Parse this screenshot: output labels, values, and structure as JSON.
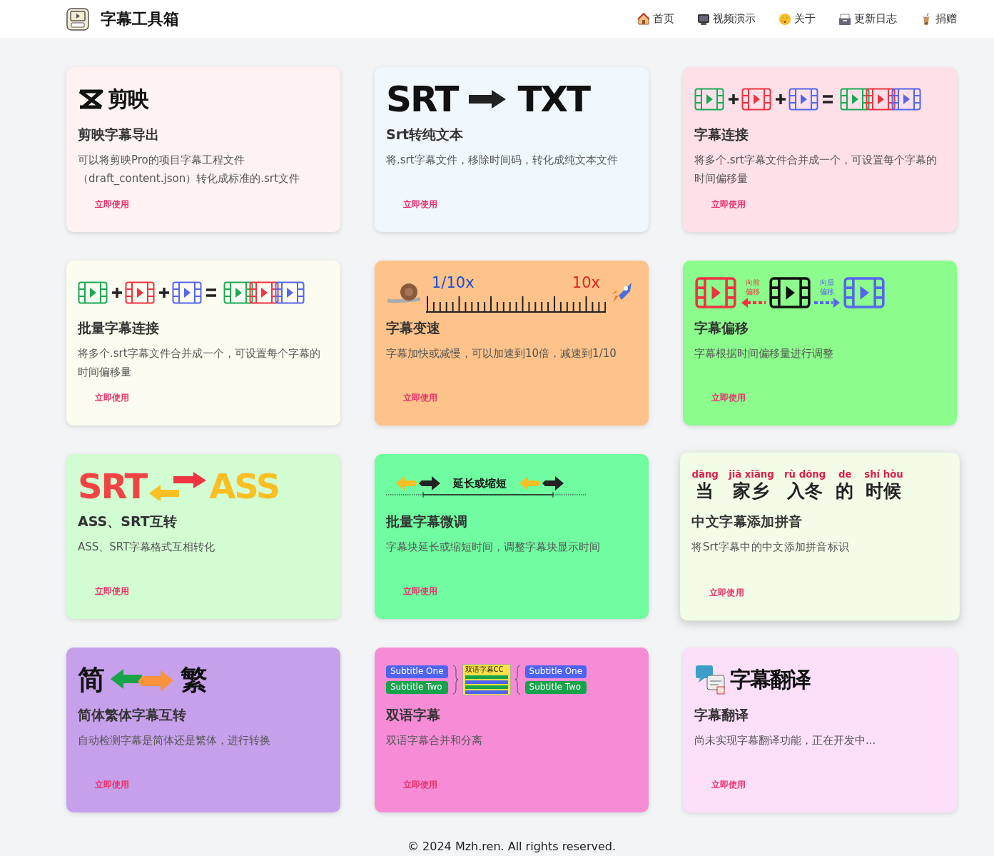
{
  "navbar": {
    "brand": "字幕工具箱",
    "links": [
      {
        "label": "首页"
      },
      {
        "label": "视频演示"
      },
      {
        "label": "关于"
      },
      {
        "label": "更新日志"
      },
      {
        "label": "捐赠"
      }
    ]
  },
  "cards": [
    {
      "color": "#fef2f2",
      "raised": false,
      "banner": {
        "kind": "jianying",
        "texts": [
          "剪映"
        ]
      },
      "title": "剪映字幕导出",
      "description": "可以将剪映Pro的项目字幕工程文件（draft_content.json）转化成标准的.srt文件",
      "action": "立即使用"
    },
    {
      "color": "#f0f7fd",
      "raised": false,
      "banner": {
        "kind": "srt_txt",
        "texts": [
          "SRT",
          "TXT"
        ]
      },
      "title": "Srt转纯文本",
      "description": "将.srt字幕文件，移除时间码，转化成纯文本文件",
      "action": "立即使用"
    },
    {
      "color": "#fde0e8",
      "raised": false,
      "banner": {
        "kind": "merge"
      },
      "title": "字幕连接",
      "description": "将多个.srt字幕文件合并成一个，可设置每个字幕的时间偏移量",
      "action": "立即使用"
    },
    {
      "color": "#fcfcf0",
      "raised": false,
      "banner": {
        "kind": "merge"
      },
      "title": "批量字幕连接",
      "description": "将多个.srt字幕文件合并成一个，可设置每个字幕的时间偏移量",
      "action": "立即使用"
    },
    {
      "color": "#fec38a",
      "raised": false,
      "banner": {
        "kind": "speed",
        "texts": [
          "1/10x",
          "10x"
        ]
      },
      "title": "字幕变速",
      "description": "字幕加快或减慢，可以加速到10倍，减速到1/10",
      "action": "立即使用"
    },
    {
      "color": "#8cfc8c",
      "raised": false,
      "banner": {
        "kind": "offset",
        "texts": [
          "向前偏移",
          "向后偏移"
        ]
      },
      "title": "字幕偏移",
      "description": "字幕根据时间偏移量进行调整",
      "action": "立即使用"
    },
    {
      "color": "#d2fcd2",
      "raised": false,
      "banner": {
        "kind": "srt_ass",
        "texts": [
          "SRT",
          "ASS"
        ]
      },
      "title": "ASS、SRT互转",
      "description": "ASS、SRT字幕格式互相转化",
      "action": "立即使用"
    },
    {
      "color": "#70fca0",
      "raised": false,
      "banner": {
        "kind": "fine_tune",
        "texts": [
          "延长或缩短"
        ]
      },
      "title": "批量字幕微调",
      "description": "字幕块延长或缩短时间，调整字幕块显示时间",
      "action": "立即使用"
    },
    {
      "color": "#f2fce6",
      "raised": true,
      "banner": {
        "kind": "pinyin",
        "pairs": [
          {
            "pinyin": "dāng",
            "hanzi": "当"
          },
          {
            "pinyin": "jiā xiāng",
            "hanzi": "家乡"
          },
          {
            "pinyin": "rù dōng",
            "hanzi": "入冬"
          },
          {
            "pinyin": "de",
            "hanzi": "的"
          },
          {
            "pinyin": "shí hòu",
            "hanzi": "时候"
          }
        ]
      },
      "title": "中文字幕添加拼音",
      "description": "将Srt字幕中的中文添加拼音标识",
      "action": "立即使用"
    },
    {
      "color": "#c6a0ea",
      "raised": false,
      "banner": {
        "kind": "simp_trad",
        "texts": [
          "简",
          "繁"
        ]
      },
      "title": "简体繁体字幕互转",
      "description": "自动检测字幕是简体还是繁体，进行转换",
      "action": "立即使用"
    },
    {
      "color": "#f68cd6",
      "raised": false,
      "banner": {
        "kind": "bilingual",
        "texts": [
          "Subtitle One",
          "Subtitle Two",
          "双语字幕CC",
          "Subtitle One",
          "Subtitle Two"
        ]
      },
      "title": "双语字幕",
      "description": "双语字幕合并和分离",
      "action": "立即使用"
    },
    {
      "color": "#fce0fa",
      "raised": false,
      "banner": {
        "kind": "translate",
        "texts": [
          "字幕翻译"
        ]
      },
      "title": "字幕翻译",
      "description": "尚未实现字幕翻译功能，正在开发中...",
      "action": "立即使用"
    }
  ],
  "footer": "© 2024 Mzh.ren. All rights reserved."
}
